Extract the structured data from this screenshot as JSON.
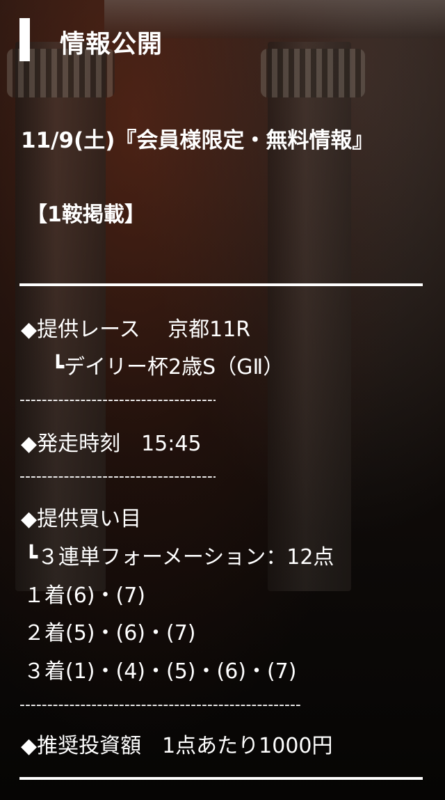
{
  "header": {
    "title": "情報公開"
  },
  "headline": "11/9(土)『会員様限定・無料情報』",
  "feature_label": "【1鞍掲載】",
  "race": {
    "label": "◆提供レース　 京都11R",
    "name": "┗デイリー杯2歳S（GⅡ）"
  },
  "separator_short": "-------------------------------------",
  "start_time": "◆発走時刻　15:45",
  "separator_short_2": "-------------------------------------",
  "bets": {
    "label": "◆提供買い目",
    "type": "┗３連単フォーメーション：12点",
    "first": "１着(6)・(7)",
    "second": "２着(5)・(6)・(7)",
    "third": "３着(1)・(4)・(5)・(6)・(7)"
  },
  "separator_long": "-------------------------------------------------------",
  "investment": "◆推奨投資額　1点あたり1000円"
}
